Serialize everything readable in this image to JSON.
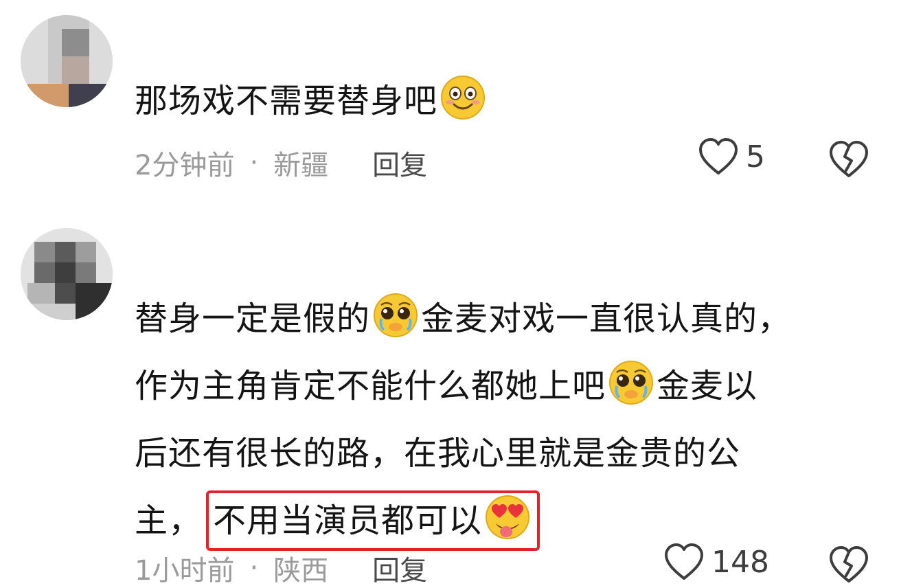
{
  "comments": [
    {
      "text_lines": [
        "那场戏不需要替身吧"
      ],
      "time": "2分钟前",
      "separator": "·",
      "location": "新疆",
      "reply_label": "回复",
      "likes": "5"
    },
    {
      "line1_a": "替身一定是假的",
      "line1_b": "金麦对戏一直很认真的，",
      "line2_a": "作为主角肯定不能什么都她上吧",
      "line2_b": "金麦以",
      "line3": "后还有很长的路，在我心里就是金贵的公",
      "line4_a": "主，",
      "line4_highlight": "不用当演员都可以",
      "time": "1小时前",
      "separator": "·",
      "location": "陕西",
      "reply_label": "回复",
      "likes": "148"
    }
  ],
  "icons": {
    "smile_emoji": "smiling-face-emoji",
    "pleading_emoji": "pleading-face-emoji",
    "heart_eyes_emoji": "heart-eyes-tongue-emoji",
    "like": "heart-outline-icon",
    "dislike": "broken-heart-icon"
  },
  "colors": {
    "highlight_border": "#e0242a",
    "meta_text": "#9a9a9a"
  }
}
